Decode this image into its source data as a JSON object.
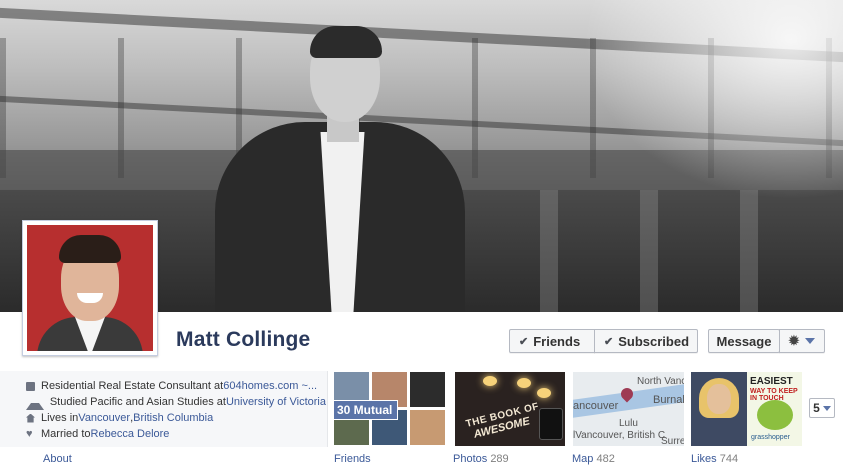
{
  "profile": {
    "name": "Matt Collinge"
  },
  "actions": {
    "friends_label": "Friends",
    "subscribed_label": "Subscribed",
    "message_label": "Message"
  },
  "info": {
    "work_prefix": "Residential Real Estate Consultant at ",
    "work_link": "604homes.com ~...",
    "study_prefix": "Studied Pacific and Asian Studies at ",
    "study_link": "University of Victoria",
    "lives_prefix": "Lives in ",
    "lives_city": "Vancouver",
    "lives_sep": ", ",
    "lives_region": "British Columbia",
    "married_prefix": "Married to ",
    "married_link": "Rebecca Delore"
  },
  "tiles": {
    "mutual_label": "30 Mutual",
    "book_line1": "THE BOOK OF",
    "book_line2": "AWESOME",
    "map_north_vancouver": "North Vanc",
    "map_vancouver": "ancouver",
    "map_burnaby": "Burnal",
    "map_lulu": "Lulu",
    "map_bottom": "lVancouver, British C",
    "map_surrey": "Surre",
    "likes_easiest": "EASIEST",
    "likes_way": "WAY TO KEEP IN TOUCH",
    "likes_brand": "grasshopper",
    "more_count": "5"
  },
  "tabs": {
    "about": "About",
    "friends": "Friends",
    "photos": "Photos",
    "photos_count": "289",
    "map": "Map",
    "map_count": "482",
    "likes": "Likes",
    "likes_count": "744"
  },
  "icons": {
    "work": "briefcase-icon",
    "education": "graduation-cap-icon",
    "home": "house-icon",
    "relationship": "heart-icon",
    "settings": "gear-icon",
    "check": "check-icon",
    "dropdown": "chevron-down-icon"
  },
  "colors": {
    "link": "#3b5998",
    "name": "#2b3a5c",
    "mutual_badge": "#5b74a8",
    "button_bg": "#f5f6f7"
  }
}
